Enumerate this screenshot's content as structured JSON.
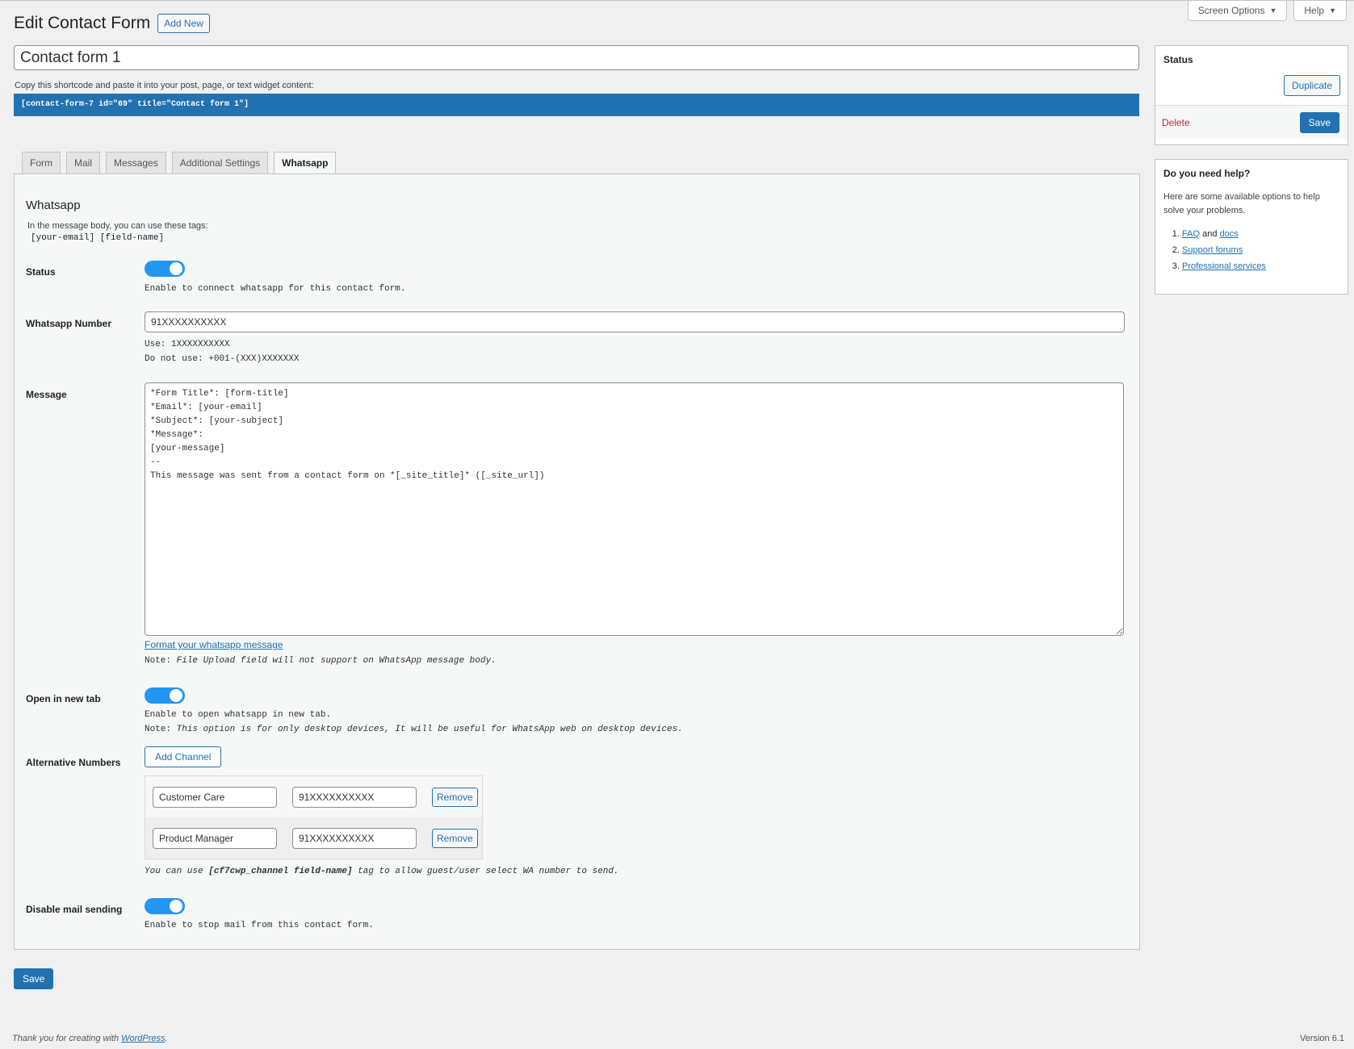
{
  "meta_links": {
    "screen_options": "Screen Options",
    "help": "Help"
  },
  "header": {
    "title": "Edit Contact Form",
    "add_new": "Add New"
  },
  "form_title": "Contact form 1",
  "shortcode": {
    "label": "Copy this shortcode and paste it into your post, page, or text widget content:",
    "value": "[contact-form-7 id=\"69\" title=\"Contact form 1\"]"
  },
  "tabs": [
    "Form",
    "Mail",
    "Messages",
    "Additional Settings",
    "Whatsapp"
  ],
  "whatsapp": {
    "title": "Whatsapp",
    "desc": "In the message body, you can use these tags:",
    "tags": "[your-email] [field-name]",
    "status": {
      "label": "Status",
      "hint": "Enable to connect whatsapp for this contact form."
    },
    "number": {
      "label": "Whatsapp Number",
      "value": "91XXXXXXXXXX",
      "hint_use": "Use: 1XXXXXXXXXX",
      "hint_dont": "Do not use: +001-(XXX)XXXXXXX"
    },
    "message": {
      "label": "Message",
      "value": "*Form Title*: [form-title]\n*Email*: [your-email]\n*Subject*: [your-subject]\n*Message*:\n[your-message]\n--\nThis message was sent from a contact form on *[_site_title]* ([_site_url])",
      "format_link": "Format your whatsapp message",
      "note_label": "Note:",
      "note": "File Upload field will not support on WhatsApp message body."
    },
    "new_tab": {
      "label": "Open in new tab",
      "hint": "Enable to open whatsapp in new tab.",
      "note_label": "Note:",
      "note": "This option is for only desktop devices, It will be useful for WhatsApp web on desktop devices."
    },
    "alternative": {
      "label": "Alternative Numbers",
      "add_button": "Add Channel",
      "channels": [
        {
          "name": "Customer Care",
          "number": "91XXXXXXXXXX",
          "remove": "Remove"
        },
        {
          "name": "Product Manager",
          "number": "91XXXXXXXXXX",
          "remove": "Remove"
        }
      ],
      "hint_pre": "You can use",
      "hint_tag": "[cf7cwp_channel field-name]",
      "hint_post": "tag to allow guest/user select WA number to send."
    },
    "disable_mail": {
      "label": "Disable mail sending",
      "hint": "Enable to stop mail from this contact form."
    }
  },
  "save_label": "Save",
  "sidebar": {
    "status_title": "Status",
    "duplicate": "Duplicate",
    "delete": "Delete",
    "save": "Save",
    "help_title": "Do you need help?",
    "help_text": "Here are some available options to help solve your problems.",
    "faq": "FAQ",
    "and": "and",
    "docs": "docs",
    "support": "Support forums",
    "professional": "Professional services"
  },
  "footer": {
    "thanks_pre": "Thank you for creating with",
    "wordpress": "WordPress",
    "thanks_post": ".",
    "version": "Version 6.1"
  },
  "colors": {
    "accent": "#2271b1",
    "toggle": "#2196f3",
    "delete": "#b32d2e"
  }
}
